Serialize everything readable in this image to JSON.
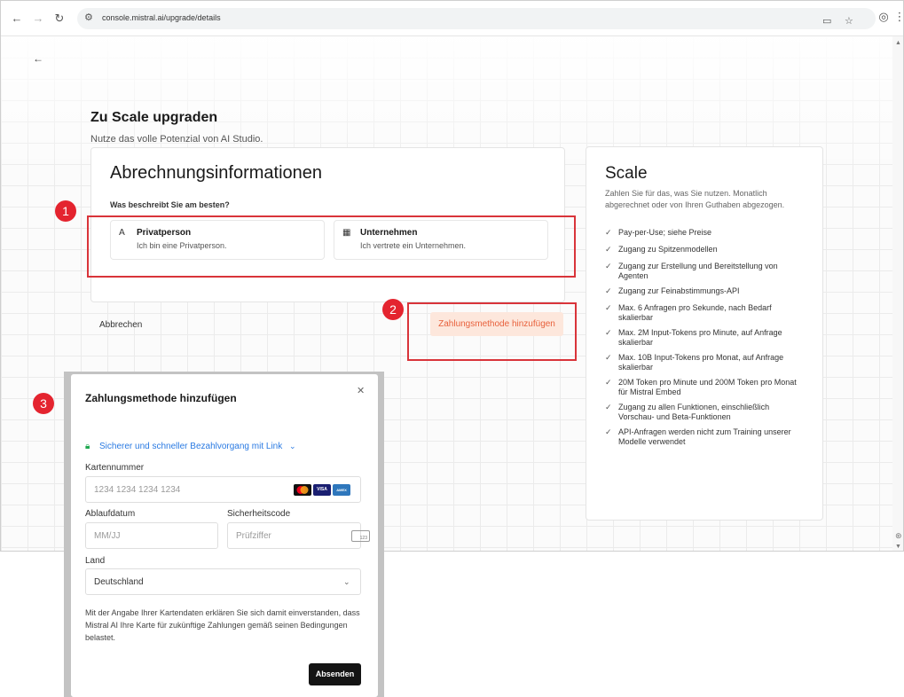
{
  "browser": {
    "url": "console.mistral.ai/upgrade/details",
    "icons": [
      "back-arrow-icon",
      "forward-arrow-icon",
      "reload-icon",
      "site-settings-icon",
      "cast-icon",
      "bookmark-star-icon",
      "profile-icon",
      "menu-dots-icon"
    ]
  },
  "page": {
    "title": "Zu Scale upgraden",
    "subtitle": "Nutze das volle Potenzial von AI Studio."
  },
  "billing": {
    "title": "Abrechnungsinformationen",
    "question": "Was beschreibt Sie am besten?",
    "options": [
      {
        "title": "Privatperson",
        "description": "Ich bin eine Privatperson.",
        "icon": "person-icon"
      },
      {
        "title": "Unternehmen",
        "description": "Ich vertrete ein Unternehmen.",
        "icon": "building-icon"
      }
    ],
    "cancel_label": "Abbrechen",
    "add_payment_label": "Zahlungsmethode hinzufügen"
  },
  "annotations": {
    "badges": [
      "1",
      "2",
      "3"
    ],
    "color": "#d9343a"
  },
  "scale": {
    "title": "Scale",
    "description": "Zahlen Sie für das, was Sie nutzen. Monatlich abgerechnet oder von Ihren Guthaben abgezogen.",
    "features": [
      "Pay-per-Use; siehe Preise",
      "Zugang zu Spitzenmodellen",
      "Zugang zur Erstellung und Bereitstellung von Agenten",
      "Zugang zur Feinabstimmungs-API",
      "Max. 6 Anfragen pro Sekunde, nach Bedarf skalierbar",
      "Max. 2M Input-Tokens pro Minute, auf Anfrage skalierbar",
      "Max. 10B Input-Tokens pro Monat, auf Anfrage skalierbar",
      "20M Token pro Minute und 200M Token pro Monat für Mistral Embed",
      "Zugang zu allen Funktionen, einschließlich Vorschau- und Beta-Funktionen",
      "API-Anfragen werden nicht zum Training unserer Modelle verwendet"
    ]
  },
  "modal": {
    "title": "Zahlungsmethode hinzufügen",
    "close_icon": "close-icon",
    "link_label": "Sicherer und schneller Bezahlvorgang mit Link",
    "card_number_label": "Kartennummer",
    "card_number_placeholder": "1234 1234 1234 1234",
    "card_brands": [
      "mastercard",
      "VISA",
      "AMEX"
    ],
    "expiry_label": "Ablaufdatum",
    "expiry_placeholder": "MM/JJ",
    "cvc_label": "Sicherheitscode",
    "cvc_placeholder": "Prüfziffer",
    "cvc_icon_text": "123",
    "country_label": "Land",
    "country_value": "Deutschland",
    "consent": "Mit der Angabe Ihrer Kartendaten erklären Sie sich damit einverstanden, dass Mistral AI Ihre Karte für zukünftige Zahlungen gemäß seinen Bedingungen belastet.",
    "submit_label": "Absenden"
  }
}
